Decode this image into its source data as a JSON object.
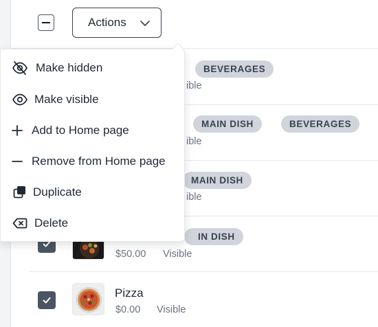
{
  "toolbar": {
    "actions_label": "Actions"
  },
  "menu": {
    "items": [
      {
        "label": "Make hidden",
        "icon": "eye-off-icon"
      },
      {
        "label": "Make visible",
        "icon": "eye-icon"
      },
      {
        "label": "Add to Home page",
        "icon": "plus-icon"
      },
      {
        "label": "Remove from Home page",
        "icon": "minus-icon"
      },
      {
        "label": "Duplicate",
        "icon": "duplicate-icon"
      },
      {
        "label": "Delete",
        "icon": "delete-icon"
      }
    ]
  },
  "rows": [
    {
      "visibility": "ible",
      "tags": [
        "BEVERAGES"
      ]
    },
    {
      "visibility": "ible",
      "tags": [
        "MAIN DISH",
        "BEVERAGES"
      ]
    },
    {
      "visibility": "ible",
      "tags": [
        "MAIN DISH"
      ]
    },
    {
      "price": "$50.00",
      "visibility": "Visible",
      "tags": [
        "IN DISH"
      ],
      "checked": true
    },
    {
      "name": "Pizza",
      "price": "$0.00",
      "visibility": "Visible",
      "tags": [],
      "checked": true
    }
  ],
  "colors": {
    "tag_bg": "#d1d5db",
    "checkbox": "#4b5563"
  }
}
